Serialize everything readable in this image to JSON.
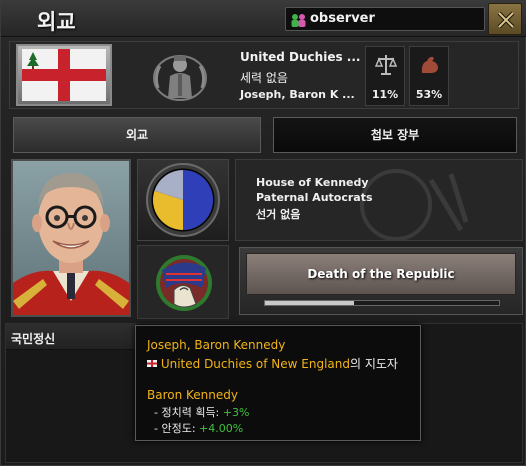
{
  "window": {
    "title": "외교"
  },
  "observer": {
    "label": "observer"
  },
  "country": {
    "name": "United Duchies ...",
    "faction": "세력 없음",
    "leader_short": "Joseph, Baron K ..."
  },
  "stats": {
    "political_power_percent": "11%",
    "war_support_percent": "53%"
  },
  "tabs": {
    "diplomacy": "외교",
    "intelligence": "첩보 장부"
  },
  "party": {
    "name": "House of Kennedy",
    "ideology": "Paternal Autocrats",
    "elections": "선거 없음"
  },
  "ideology_pie": [
    {
      "share": 0.5,
      "color": "#2f3fb8"
    },
    {
      "share": 0.3,
      "color": "#e8bc2c"
    },
    {
      "share": 0.2,
      "color": "#a8b0c8"
    }
  ],
  "focus": {
    "label": "Death of the Republic",
    "progress": 0.38
  },
  "national_spirits": {
    "label": "국민정신"
  },
  "tooltip": {
    "leader_name": "Joseph, Baron Kennedy",
    "leader_of_country": "United Duchies of New England",
    "leader_of_suffix": "의 지도자",
    "trait_name": "Baron Kennedy",
    "effect1_label": "- 정치력 획득: ",
    "effect1_value": "+3%",
    "effect2_label": "- 안정도: ",
    "effect2_value": "+4.00%"
  },
  "colors": {
    "accent_gold": "#f2b418",
    "positive_green": "#3fc23f"
  }
}
